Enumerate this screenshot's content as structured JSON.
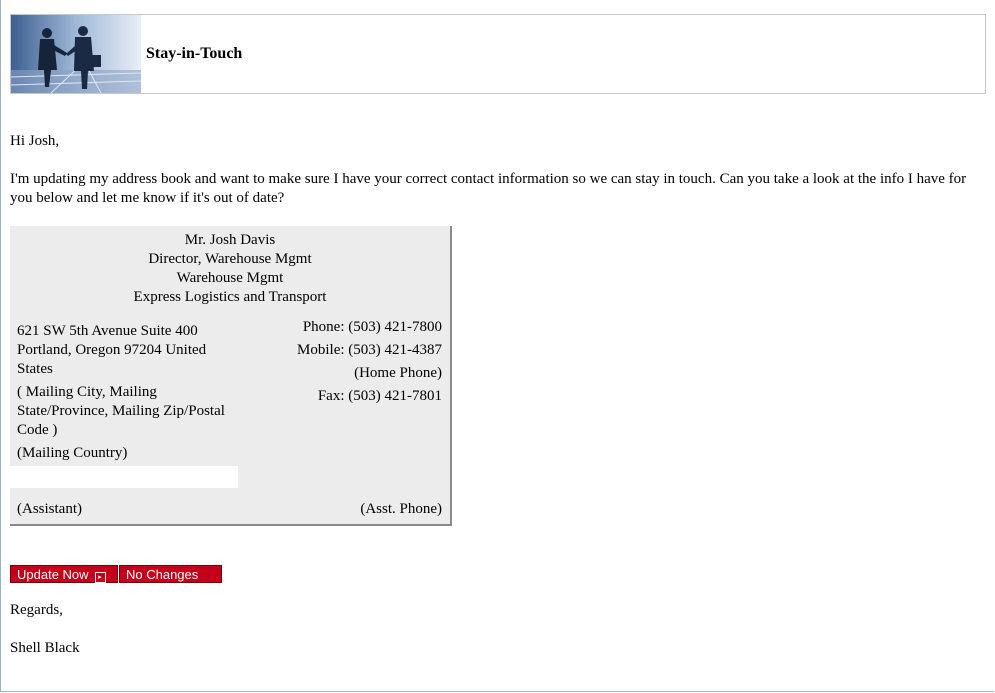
{
  "header": {
    "title": "Stay-in-Touch"
  },
  "greeting": "Hi Josh,",
  "intro": "I'm updating my address book and want to make sure I have your correct contact information so we can stay in touch. Can you take a look at the info I have for you below and let me know if it's out of date?",
  "contact": {
    "name": "Mr. Josh Davis",
    "title": "Director, Warehouse Mgmt",
    "department": "Warehouse Mgmt",
    "company": "Express Logistics and Transport",
    "address_line1": "621 SW 5th Avenue Suite 400",
    "address_line2": "Portland, Oregon 97204 United",
    "address_line3": "States",
    "mailing_line1": "( Mailing City, Mailing",
    "mailing_line2": "State/Province, Mailing Zip/Postal",
    "mailing_line3": "Code )",
    "mailing_country": "(Mailing Country)",
    "phone": "Phone: (503) 421-7800",
    "mobile": "Mobile: (503) 421-4387",
    "home_phone": "(Home Phone)",
    "fax": "Fax: (503) 421-7801",
    "assistant": "(Assistant)",
    "asst_phone": "(Asst. Phone)"
  },
  "buttons": {
    "update": "Update Now",
    "no_changes": "No Changes"
  },
  "closing": "Regards,",
  "signature": "Shell Black"
}
